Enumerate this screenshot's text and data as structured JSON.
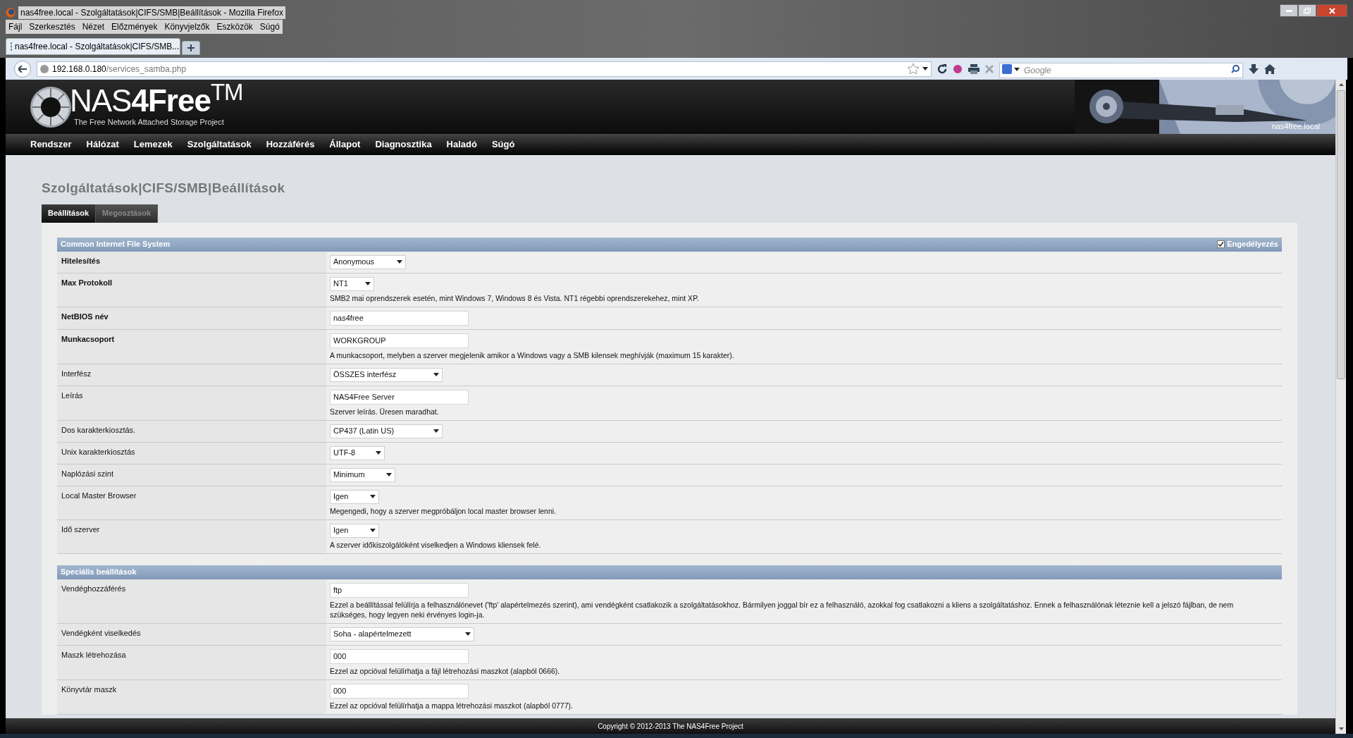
{
  "window": {
    "title": "nas4free.local - Szolgáltatások|CIFS/SMB|Beállítások - Mozilla Firefox",
    "menu": [
      "Fájl",
      "Szerkesztés",
      "Nézet",
      "Előzmények",
      "Könyvjelzők",
      "Eszközök",
      "Súgó"
    ],
    "tab": {
      "title": "nas4free.local - Szolgáltatások|CIFS/SMB..."
    },
    "url": {
      "host": "192.168.0.180",
      "path": "/services_samba.php"
    },
    "search": {
      "placeholder": "Google"
    }
  },
  "header": {
    "logo": "NAS**4Free**$^{TM}$",
    "tagline": "The Free Network Attached Storage Project",
    "hostname": "nas4free.local"
  },
  "nav": [
    "Rendszer",
    "Hálózat",
    "Lemezek",
    "Szolgáltatások",
    "Hozzáférés",
    "Állapot",
    "Diagnosztika",
    "Haladó",
    "Súgó"
  ],
  "page_title": "Szolgáltatások|CIFS/SMB|Beállítások",
  "tabs": [
    {
      "label": "Beállítások",
      "selected": true
    },
    {
      "label": "Megosztások",
      "selected": false
    }
  ],
  "sections": [
    {
      "title": "Common Internet File System",
      "enable": {
        "label": "Engedélyezés",
        "checked": true
      },
      "rows": [
        {
          "label": "Hitelesítés",
          "bold": true,
          "kind": "select",
          "value": "Anonymous"
        },
        {
          "label": "Max Protokoll",
          "bold": true,
          "kind": "select",
          "value": "NT1",
          "hint": "SMB2 mai oprendszerek esetén, mint Windows 7, Windows 8 és Vista. NT1 régebbi oprendszerekehez, mint XP."
        },
        {
          "label": "NetBIOS név",
          "bold": true,
          "kind": "text",
          "value": "nas4free"
        },
        {
          "label": "Munkacsoport",
          "bold": true,
          "kind": "text",
          "value": "WORKGROUP",
          "hint": "A munkacsoport, melyben a szerver megjelenik amikor a Windows vagy a SMB kilensek meghívják (maximum 15 karakter)."
        },
        {
          "label": "Interfész",
          "bold": false,
          "kind": "select",
          "value": "ÖSSZES interfész"
        },
        {
          "label": "Leírás",
          "bold": false,
          "kind": "text",
          "value": "NAS4Free Server",
          "hint": "Szerver leírás. Üresen maradhat."
        },
        {
          "label": "Dos karakterkiosztás.",
          "bold": false,
          "kind": "select",
          "value": "CP437 (Latin US)"
        },
        {
          "label": "Unix karakterkiosztás",
          "bold": false,
          "kind": "select",
          "value": "UTF-8"
        },
        {
          "label": "Naplózási szint",
          "bold": false,
          "kind": "select",
          "value": "Minimum"
        },
        {
          "label": "Local Master Browser",
          "bold": false,
          "kind": "select",
          "value": "Igen",
          "hint": "Megengedi, hogy a szerver megpróbáljon local master browser lenni."
        },
        {
          "label": "Idő szerver",
          "bold": false,
          "kind": "select",
          "value": "Igen",
          "hint": "A szerver időkiszolgálóként viselkedjen a Windows kliensek felé."
        }
      ]
    },
    {
      "title": "Speciális beállítások",
      "rows": [
        {
          "label": "Vendéghozzáférés",
          "bold": false,
          "kind": "text",
          "value": "ftp",
          "hint": "Ezzel a beállítással felülírja a felhasználónevet ('ftp' alapértelmezés szerint), ami vendégként csatlakozik a szolgáltatásokhoz. Bármilyen joggal bír ez a felhasználó, azokkal fog csatlakozni a kliens a szolgáltatáshoz. Ennek a felhasználónak léteznie kell a jelszó fájlban, de nem szükséges, hogy legyen neki érvényes login-ja."
        },
        {
          "label": "Vendégként viselkedés",
          "bold": false,
          "kind": "select",
          "value": "Soha - alapértelmezett"
        },
        {
          "label": "Maszk létrehozása",
          "bold": false,
          "kind": "text",
          "value": "000",
          "hint": "Ezzel az opcióval felülírhatja a fájl létrehozási maszkot (alapból 0666)."
        },
        {
          "label": "Könyvtár maszk",
          "bold": false,
          "kind": "text",
          "value": "000",
          "hint": "Ezzel az opcióval felülírhatja a mappa létrehozási maszkot (alapból 0777)."
        }
      ]
    }
  ],
  "footer": "Copyright © 2012-2013 The NAS4Free Project"
}
